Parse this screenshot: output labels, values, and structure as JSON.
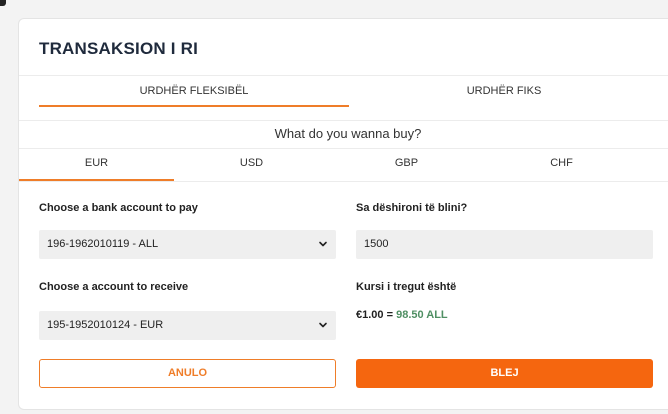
{
  "page": {
    "title": "TRANSAKSION I RI",
    "accent_color": "#f5660f",
    "rate_value_color": "#4f8f63"
  },
  "order_tabs": [
    {
      "label": "URDHËR FLEKSIBËL",
      "active": true
    },
    {
      "label": "URDHËR FIKS",
      "active": false
    }
  ],
  "question": "What do you wanna buy?",
  "currency_tabs": [
    {
      "label": "EUR",
      "active": true
    },
    {
      "label": "USD",
      "active": false
    },
    {
      "label": "GBP",
      "active": false
    },
    {
      "label": "CHF",
      "active": false
    }
  ],
  "pay_account": {
    "label": "Choose a bank account to pay",
    "value": "196-1962010119 - ALL",
    "icon": "chevron-down-icon"
  },
  "receive_account": {
    "label": "Choose a account to receive",
    "value": "195-1952010124 - EUR",
    "icon": "chevron-down-icon"
  },
  "amount": {
    "label": "Sa dëshironi të blini?",
    "value": "1500"
  },
  "rate": {
    "label": "Kursi i tregut është",
    "prefix": "€1.00 = ",
    "value": "98.50 ALL"
  },
  "actions": {
    "cancel_label": "ANULO",
    "buy_label": "BLEJ"
  }
}
